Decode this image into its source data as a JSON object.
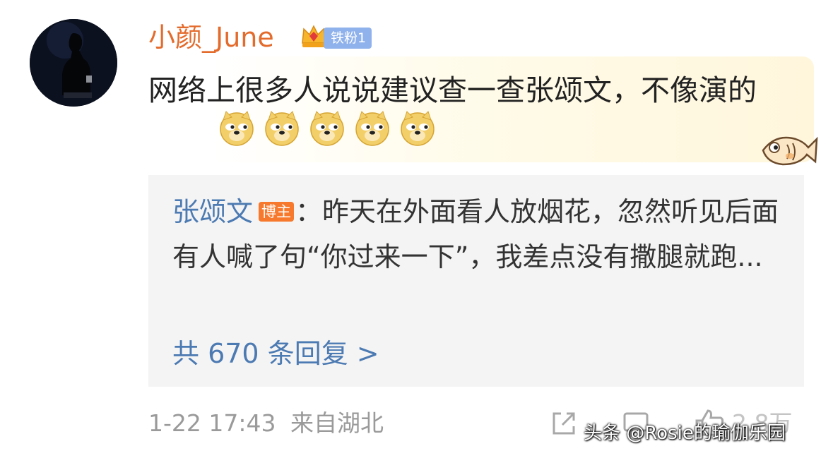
{
  "comment": {
    "username": "小颜_June",
    "fan_badge": "铁粉1",
    "text": "网络上很多人说说建议查一查张颂文，不像演的",
    "emoji_count": 5,
    "emoji_name": "doge-emoji"
  },
  "quoted_post": {
    "author": "张颂文",
    "author_badge": "博主",
    "text": "：昨天在外面看人放烟花，忽然听见后面有人喊了句“你过来一下”，我差点没有撒腿就跑...",
    "reply_link": "共 670 条回复 >"
  },
  "meta": {
    "date_time": "1-22 17:43",
    "location": "来自湖北",
    "like_count": "2.8万"
  },
  "watermark": "头条 @Rosie的瑜伽乐园",
  "colors": {
    "username": "#e36b2c",
    "link": "#4c7ab2",
    "badge_blue": "#8fb2ec",
    "badge_orange": "#f6792d"
  }
}
